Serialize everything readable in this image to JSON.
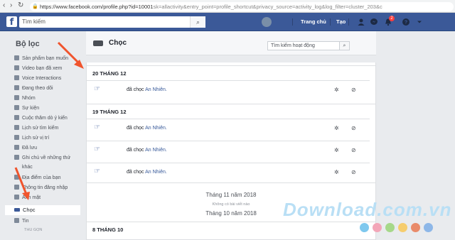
{
  "browser": {
    "url_host": "https://www.facebook.com/profile.php?id=10001",
    "url_rest": "sk=allactivity&entry_point=profile_shortcut&privacy_source=activity_log&log_filter=cluster_203&c"
  },
  "fb_header": {
    "logo": "f",
    "search_placeholder": "Tìm kiếm",
    "home": "Trang chủ",
    "create": "Tạo",
    "notifications_count": "2"
  },
  "sidebar": {
    "title": "Bộ lọc",
    "items": [
      "Sản phẩm bạn muốn",
      "Video bạn đã xem",
      "Voice Interactions",
      "Đang theo dõi",
      "Nhóm",
      "Sự kiện",
      "Cuộc thăm dò ý kiến",
      "Lịch sử tìm kiếm",
      "Lịch sử vị trí",
      "Đã lưu",
      "Ghi chú về những thứ",
      "khác",
      "Địa điểm của bạn",
      "Thông tin đăng nhập",
      "Ảnh mặt",
      "Chọc",
      "Tin",
      "THU GỌN"
    ],
    "active": "Chọc",
    "collapse": "THU GỌN"
  },
  "panel": {
    "title": "Chọc",
    "search_placeholder": "Tìm kiếm hoạt động",
    "faint_note": "Không có bài viết nào"
  },
  "groups": [
    {
      "date": "20 THÁNG 12",
      "rows": [
        {
          "action": "đã chọc",
          "name": "An Nhiên."
        }
      ]
    },
    {
      "date": "19 THÁNG 12",
      "rows": [
        {
          "action": "đã chọc",
          "name": "An Nhiên."
        },
        {
          "action": "đã chọc",
          "name": "An Nhiên."
        },
        {
          "action": "đã chọc",
          "name": "An Nhiên."
        }
      ]
    }
  ],
  "months": {
    "nov": "Tháng 11 năm 2018",
    "no_posts": "Không có bài viết nào",
    "oct": "Tháng 10 năm 2018"
  },
  "last_date": "8 THÁNG 10",
  "watermark": "Download.com.vn",
  "colors": {
    "fb_blue": "#3b5998",
    "link": "#365899",
    "arrow": "#f0542d",
    "badge": "#fa3e3e"
  }
}
